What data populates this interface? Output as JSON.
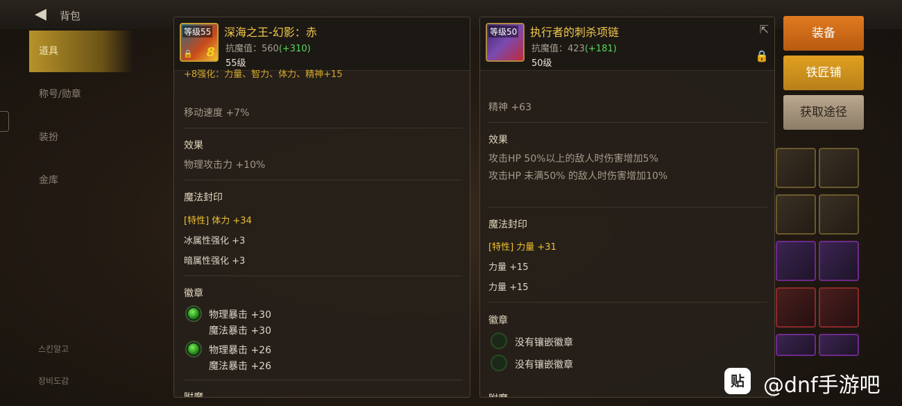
{
  "top": {
    "title": "背包"
  },
  "nav": {
    "items": [
      "道具",
      "称号/勋章",
      "装扮",
      "金库"
    ],
    "bottom": [
      "스킨알고",
      "장비도감"
    ]
  },
  "item1": {
    "level_badge": "等级55",
    "enhance_badge": "8",
    "name": "深海之王-幻影：赤",
    "stat_label": "抗魔值：",
    "stat_base": "560",
    "stat_bonus": "(+310)",
    "level": "55级",
    "lines": {
      "cut": "+8强化：力量、智力、体力、精神+15",
      "move": "移动速度 +7%",
      "effect_title": "效果",
      "effect": "物理攻击力 +10%",
      "seal_title": "魔法封印",
      "seal": [
        "[特性] 体力 +34",
        "冰属性强化 +3",
        "暗属性强化 +3"
      ],
      "badge_title": "徽章",
      "badges": [
        [
          "物理暴击 +30",
          "魔法暴击 +30"
        ],
        [
          "物理暴击 +26",
          "魔法暴击 +26"
        ]
      ],
      "enchant_title": "附魔"
    }
  },
  "item2": {
    "level_badge": "等级50",
    "name": "执行者的刺杀项链",
    "stat_label": "抗魔值：",
    "stat_base": "423",
    "stat_bonus": "(+181)",
    "level": "50级",
    "lines": {
      "spirit": "精神 +63",
      "effect_title": "效果",
      "effects": [
        "攻击HP 50%以上的敌人时伤害增加5%",
        "攻击HP 未满50% 的敌人时伤害增加10%"
      ],
      "seal_title": "魔法封印",
      "seal": [
        "[特性] 力量 +31",
        "力量 +15",
        "力量 +15"
      ],
      "badge_title": "徽章",
      "badges": [
        "没有镶嵌徽章",
        "没有镶嵌徽章"
      ],
      "enchant_title": "附魔"
    }
  },
  "buttons": {
    "equip": "装备",
    "smith": "铁匠铺",
    "source": "获取途径"
  },
  "watermark": {
    "icon": "贴",
    "text": "@dnf手游吧"
  }
}
